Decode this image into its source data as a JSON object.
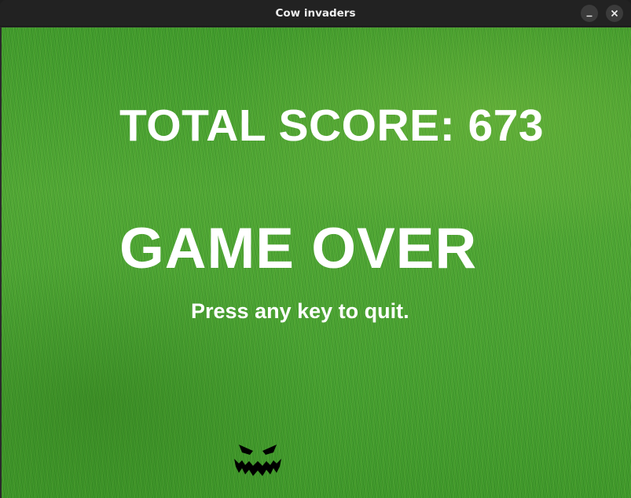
{
  "window": {
    "title": "Cow invaders",
    "controls": {
      "minimize_icon": "minimize-icon",
      "close_icon": "close-icon"
    }
  },
  "game": {
    "background": "grass-field",
    "score_text": "TOTAL SCORE: 673",
    "score": 673,
    "game_over_text": "GAME OVER",
    "quit_message": "Press any key to quit.",
    "player_sprite": "jack-o-lantern-face-icon"
  },
  "colors": {
    "text": "#ffffff",
    "grass": "#4a9c2c",
    "titlebar": "#222222"
  }
}
